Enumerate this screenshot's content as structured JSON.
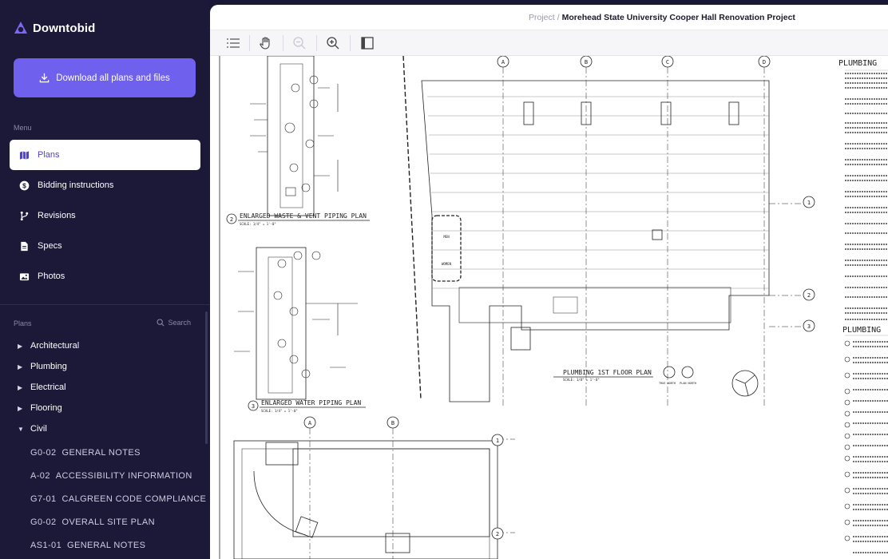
{
  "app": {
    "name": "Downtobid"
  },
  "sidebar": {
    "download_label": "Download all plans and files",
    "menu_label": "Menu",
    "menu_items": [
      {
        "label": "Plans",
        "icon": "map-icon",
        "active": true
      },
      {
        "label": "Bidding instructions",
        "icon": "dollar-icon",
        "active": false
      },
      {
        "label": "Revisions",
        "icon": "branch-icon",
        "active": false
      },
      {
        "label": "Specs",
        "icon": "document-icon",
        "active": false
      },
      {
        "label": "Photos",
        "icon": "photo-icon",
        "active": false
      }
    ],
    "plans_label": "Plans",
    "search_label": "Search",
    "plan_categories": [
      {
        "label": "Architectural",
        "expanded": false
      },
      {
        "label": "Plumbing",
        "expanded": false
      },
      {
        "label": "Electrical",
        "expanded": false
      },
      {
        "label": "Flooring",
        "expanded": false
      },
      {
        "label": "Civil",
        "expanded": true
      }
    ],
    "civil_sheets": [
      {
        "code": "G0-02",
        "name": "GENERAL NOTES"
      },
      {
        "code": "A-02",
        "name": "ACCESSIBILITY INFORMATION"
      },
      {
        "code": "G7-01",
        "name": "CALGREEN CODE COMPLIANCE"
      },
      {
        "code": "G0-02",
        "name": "OVERALL SITE PLAN"
      },
      {
        "code": "AS1-01",
        "name": "GENERAL NOTES"
      }
    ]
  },
  "header": {
    "breadcrumb_root": "Project",
    "breadcrumb_separator": "/",
    "project_name": "Morehead State University Cooper Hall Renovation Project"
  },
  "toolbar": {
    "tools": [
      "list-icon",
      "pan-hand-icon",
      "zoom-out-icon",
      "zoom-in-icon",
      "panel-toggle-icon"
    ]
  },
  "drawing": {
    "waste_plan_title": "ENLARGED WASTE & VENT PIPING PLAN",
    "waste_plan_scale": "SCALE: 1/4\" = 1'-0\"",
    "water_plan_title": "ENLARGED WATER PIPING PLAN",
    "water_plan_scale": "SCALE: 1/4\" = 1'-0\"",
    "first_floor_title": "PLUMBING 1ST FLOOR PLAN",
    "first_floor_scale": "SCALE: 1/8\" = 1'-0\"",
    "true_north": "TRUE NORTH",
    "plan_north": "PLAN NORTH",
    "notes_title_1": "PLUMBING",
    "notes_title_2": "PLUMBING",
    "grid_top": [
      "A",
      "B",
      "C",
      "D"
    ],
    "grid_right": [
      "1",
      "2",
      "3"
    ],
    "grid_bottom": [
      "A",
      "B"
    ],
    "grid_bottom_right": [
      "1",
      "2"
    ],
    "sheet_numbers": [
      "2",
      "3"
    ],
    "room_labels": [
      "MEN",
      "WOMEN"
    ]
  },
  "colors": {
    "sidebar_bg": "#1b1838",
    "accent": "#7060ee",
    "active_text": "#5140d8"
  }
}
